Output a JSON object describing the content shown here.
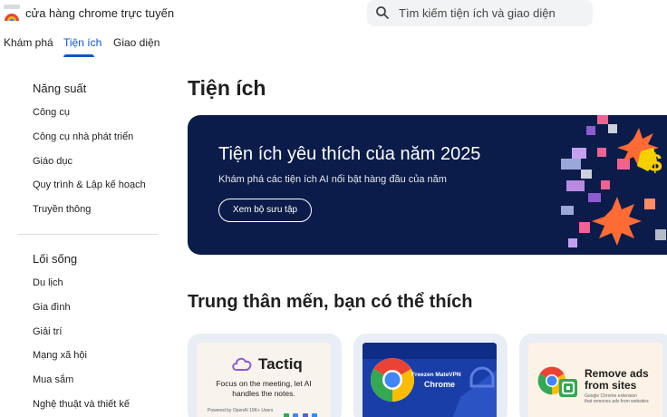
{
  "header": {
    "store_title": "cửa hàng chrome trực tuyến",
    "search_placeholder": "Tìm kiếm tiện ích và giao diện"
  },
  "tabs": [
    {
      "label": "Khám phá",
      "active": false
    },
    {
      "label": "Tiện ích",
      "active": true
    },
    {
      "label": "Giao diện",
      "active": false
    }
  ],
  "sidebar": {
    "sections": [
      {
        "heading": "Năng suất",
        "items": [
          "Công cụ",
          "Công cụ nhà phát triển",
          "Giáo dục",
          "Quy trình & Lập kế hoạch",
          "Truyền thông"
        ]
      },
      {
        "heading": "Lối sống",
        "items": [
          "Du lịch",
          "Gia đình",
          "Giải trí",
          "Mạng xã hội",
          "Mua sắm",
          "Nghệ thuật và thiết kế"
        ]
      }
    ]
  },
  "main": {
    "page_title": "Tiện ích",
    "banner": {
      "title": "Tiện ích yêu thích của năm 2025",
      "subtitle": "Khám phá các tiện ích AI nổi bật hàng đầu của năm",
      "button": "Xem bộ sưu tập"
    },
    "section_title": "Trung thân mến, bạn có thể thích",
    "cards": [
      {
        "name": "Tactiq",
        "line1": "Focus on the meeting, let AI",
        "line2": "handles the notes.",
        "footer": "Powered by  OpenAI   19K+ Users"
      },
      {
        "brand": "Freezen MateVPN",
        "name": "Chrome"
      },
      {
        "title1": "Remove ads",
        "title2": "from sites",
        "sub1": "Google Chrome extension",
        "sub2": "that removes ads from websites"
      }
    ]
  },
  "colors": {
    "accent": "#0b57d0",
    "banner_bg": "#0b1c4a",
    "card_bg": "#e9eef6",
    "search_bg": "#f1f3f4"
  }
}
